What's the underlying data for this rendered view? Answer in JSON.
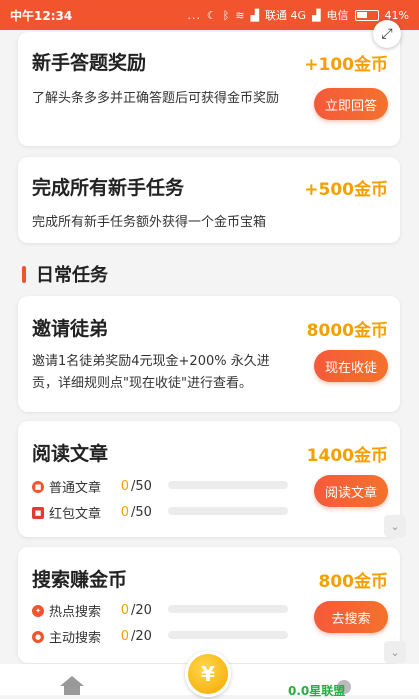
{
  "status_bar": {
    "time": "中午12:34",
    "dots": "...",
    "carrier1": "联通 4G",
    "carrier2": "电信",
    "battery": "41%"
  },
  "new_user_tasks": [
    {
      "title": "新手答题奖励",
      "reward": "+100金币",
      "description": "了解头条多多并正确答题后可获得金币奖励",
      "button": "立即回答"
    },
    {
      "title": "完成所有新手任务",
      "reward": "+500金币",
      "description": "完成所有新手任务额外获得一个金币宝箱"
    }
  ],
  "daily_section": {
    "title": "日常任务"
  },
  "daily_tasks": {
    "invite": {
      "title": "邀请徒弟",
      "reward": "8000金币",
      "description": "邀请1名徒弟奖励4元现金+200% 永久进贡，详细规则点\"现在收徒\"进行查看。",
      "button": "现在收徒"
    },
    "read": {
      "title": "阅读文章",
      "reward": "1400金币",
      "button": "阅读文章",
      "rows": [
        {
          "icon": "article-icon",
          "label": "普通文章",
          "current": "0",
          "total": "/50",
          "progress": 0
        },
        {
          "icon": "red-packet-icon",
          "label": "红包文章",
          "current": "0",
          "total": "/50",
          "progress": 0
        }
      ]
    },
    "search": {
      "title": "搜索赚金币",
      "reward": "800金币",
      "button": "去搜索",
      "rows": [
        {
          "icon": "hot-search-icon",
          "label": "热点搜索",
          "current": "0",
          "total": "/20",
          "progress": 0
        },
        {
          "icon": "search-icon",
          "label": "主动搜索",
          "current": "0",
          "total": "/20",
          "progress": 0
        }
      ]
    }
  },
  "bottom_nav": {
    "coin_symbol": "¥",
    "watermark": "0.0星联盟"
  },
  "colors": {
    "accent": "#f2552e",
    "reward": "#f5a000"
  }
}
